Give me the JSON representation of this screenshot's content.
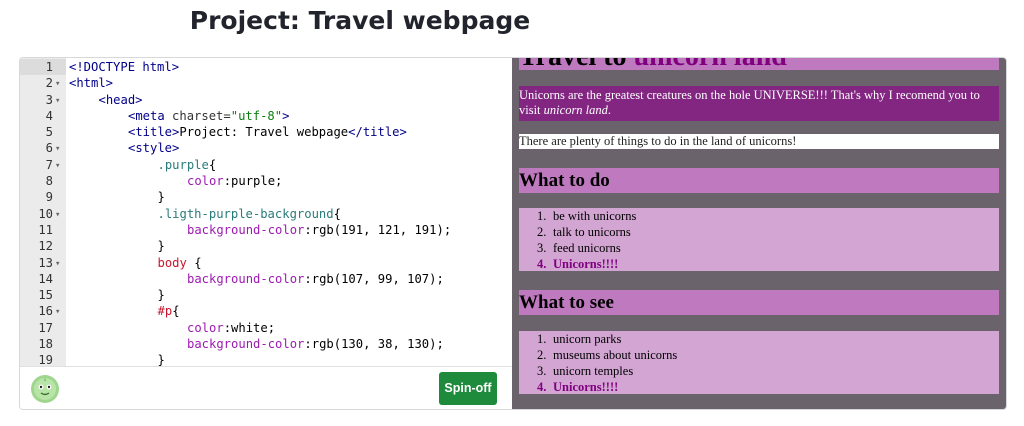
{
  "page": {
    "title": "Project: Travel webpage"
  },
  "editor": {
    "lines": [
      {
        "n": "1",
        "fold": "",
        "indent": 0,
        "tokens": [
          [
            "tag",
            "<!DOCTYPE html>"
          ]
        ]
      },
      {
        "n": "2",
        "fold": "▾",
        "indent": 0,
        "tokens": [
          [
            "tag",
            "<html>"
          ]
        ]
      },
      {
        "n": "3",
        "fold": "▾",
        "indent": 1,
        "tokens": [
          [
            "tag",
            "<head>"
          ]
        ]
      },
      {
        "n": "4",
        "fold": "",
        "indent": 2,
        "tokens": [
          [
            "tag",
            "<meta "
          ],
          [
            "attr",
            "charset="
          ],
          [
            "str",
            "\"utf-8\""
          ],
          [
            "tag",
            ">"
          ]
        ]
      },
      {
        "n": "5",
        "fold": "",
        "indent": 2,
        "tokens": [
          [
            "tag",
            "<title>"
          ],
          [
            "plain",
            "Project: Travel webpage"
          ],
          [
            "tag",
            "</title>"
          ]
        ]
      },
      {
        "n": "6",
        "fold": "▾",
        "indent": 2,
        "tokens": [
          [
            "tag",
            "<style>"
          ]
        ]
      },
      {
        "n": "7",
        "fold": "▾",
        "indent": 3,
        "tokens": [
          [
            "cls",
            ".purple"
          ],
          [
            "plain",
            "{"
          ]
        ]
      },
      {
        "n": "8",
        "fold": "",
        "indent": 4,
        "tokens": [
          [
            "prop",
            "color"
          ],
          [
            "plain",
            ":"
          ],
          [
            "plain",
            "purple;"
          ]
        ]
      },
      {
        "n": "9",
        "fold": "",
        "indent": 3,
        "tokens": [
          [
            "plain",
            "}"
          ]
        ]
      },
      {
        "n": "10",
        "fold": "▾",
        "indent": 3,
        "tokens": [
          [
            "cls",
            ".ligth-purple-background"
          ],
          [
            "plain",
            "{"
          ]
        ]
      },
      {
        "n": "11",
        "fold": "",
        "indent": 4,
        "tokens": [
          [
            "prop",
            "background-color"
          ],
          [
            "plain",
            ":rgb(191, 121, 191);"
          ]
        ]
      },
      {
        "n": "12",
        "fold": "",
        "indent": 3,
        "tokens": [
          [
            "plain",
            "}"
          ]
        ]
      },
      {
        "n": "13",
        "fold": "▾",
        "indent": 3,
        "tokens": [
          [
            "sel",
            "body"
          ],
          [
            "plain",
            " {"
          ]
        ]
      },
      {
        "n": "14",
        "fold": "",
        "indent": 4,
        "tokens": [
          [
            "prop",
            "background-color"
          ],
          [
            "plain",
            ":rgb(107, 99, 107);"
          ]
        ]
      },
      {
        "n": "15",
        "fold": "",
        "indent": 3,
        "tokens": [
          [
            "plain",
            "}"
          ]
        ]
      },
      {
        "n": "16",
        "fold": "▾",
        "indent": 3,
        "tokens": [
          [
            "sel",
            "#p"
          ],
          [
            "plain",
            "{"
          ]
        ]
      },
      {
        "n": "17",
        "fold": "",
        "indent": 4,
        "tokens": [
          [
            "prop",
            "color"
          ],
          [
            "plain",
            ":white;"
          ]
        ]
      },
      {
        "n": "18",
        "fold": "",
        "indent": 4,
        "tokens": [
          [
            "prop",
            "background-color"
          ],
          [
            "plain",
            ":rgb(130, 38, 130);"
          ]
        ]
      },
      {
        "n": "19",
        "fold": "",
        "indent": 3,
        "tokens": [
          [
            "plain",
            "}"
          ]
        ]
      }
    ],
    "spinoff_label": "Spin-off"
  },
  "preview": {
    "h1_prefix": "Travel to ",
    "h1_highlight": "unicorn land",
    "intro_text": "Unicorns are the greatest creatures on the hole UNIVERSE!!! That's why I recomend you to visit ",
    "intro_em": "unicorn land",
    "intro_end": ".",
    "plain_para": "There are plenty of things to do in the land of unicorns!",
    "section1": {
      "heading": "What to do",
      "items": [
        {
          "num": "1.",
          "text": "be with unicorns",
          "highlight": false
        },
        {
          "num": "2.",
          "text": "talk to unicorns",
          "highlight": false
        },
        {
          "num": "3.",
          "text": "feed unicorns",
          "highlight": false
        },
        {
          "num": "4.",
          "text": "Unicorns!!!!",
          "highlight": true
        }
      ]
    },
    "section2": {
      "heading": "What to see",
      "items": [
        {
          "num": "1.",
          "text": "unicorn parks",
          "highlight": false
        },
        {
          "num": "2.",
          "text": "museums about unicorns",
          "highlight": false
        },
        {
          "num": "3.",
          "text": "unicorn temples",
          "highlight": false
        },
        {
          "num": "4.",
          "text": "Unicorns!!!!",
          "highlight": true
        }
      ]
    }
  },
  "colors": {
    "spinoff_button": "#1d8a3c",
    "preview_body": "rgb(107,99,107)",
    "light_purple": "rgb(191,121,191)",
    "dark_purple": "rgb(130,38,130)"
  }
}
